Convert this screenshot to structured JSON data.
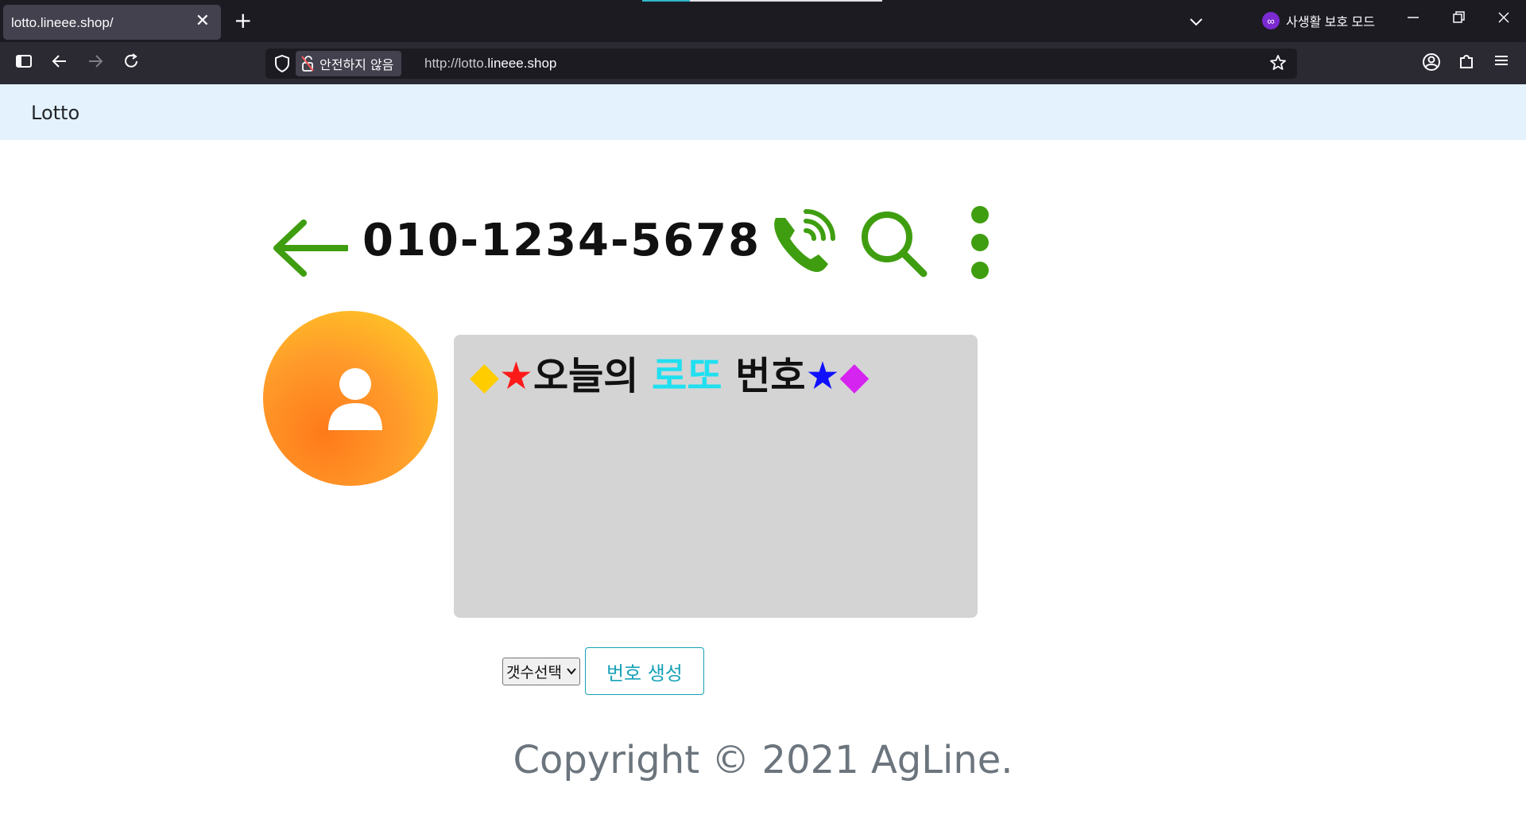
{
  "browser": {
    "tab_title": "lotto.lineee.shop/",
    "tab_close": "✕",
    "new_tab": "+",
    "private_mode_label": "사생활 보호 모드",
    "security_label": "안전하지 않음",
    "url_prefix": "http://lotto.",
    "url_host": "lineee.shop"
  },
  "site": {
    "brand": "Lotto",
    "phone_number": "010-1234-5678",
    "panel_title": {
      "diamond_left": "◆",
      "star_left": "★",
      "part1": "오늘의 ",
      "part2": "로또",
      "part3": " 번호",
      "star_right": "★",
      "diamond_right": "◆"
    },
    "count_select": {
      "selected": "갯수선택"
    },
    "generate_button": "번호 생성",
    "footer": "Copyright © 2021 AgLine."
  },
  "colors": {
    "accent_green": "#3f9e10",
    "button_teal": "#17a2b8",
    "header_bg": "#e3f2fd",
    "panel_bg": "#d4d4d4"
  },
  "icons": [
    "shield-icon",
    "unlock-icon",
    "star-icon",
    "sidebar-icon",
    "back-icon",
    "forward-icon",
    "reload-icon",
    "account-icon",
    "extensions-icon",
    "menu-icon",
    "arrow-left-icon",
    "phone-icon",
    "search-icon",
    "kebab-icon",
    "user-icon"
  ]
}
